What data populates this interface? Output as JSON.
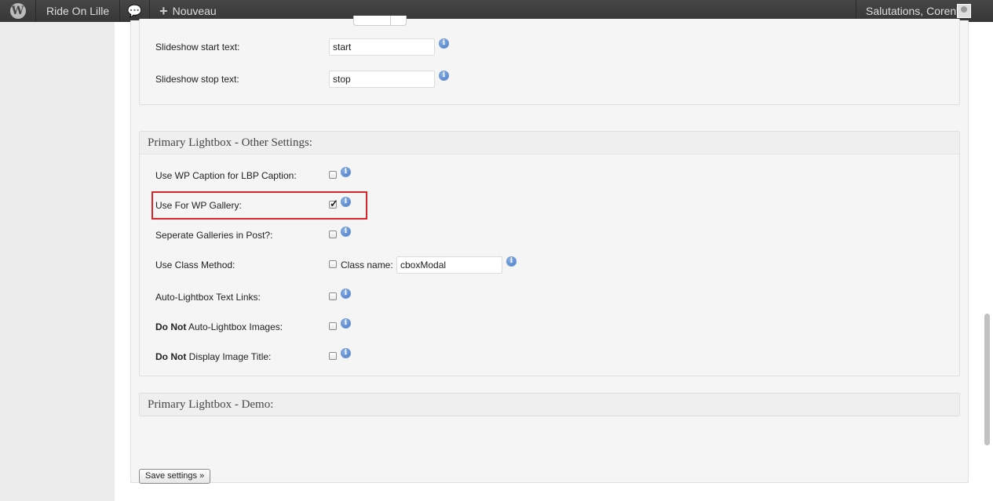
{
  "adminbar": {
    "site_name": "Ride On Lille",
    "new_label": "Nouveau",
    "greeting": "Salutations, Corentin"
  },
  "slideshow_section": {
    "rows": [
      {
        "label": "Slideshow start text:",
        "value": "start"
      },
      {
        "label": "Slideshow stop text:",
        "value": "stop"
      }
    ]
  },
  "other_settings": {
    "title": "Primary Lightbox - Other Settings:",
    "rows": [
      {
        "label": "Use WP Caption for LBP Caption:",
        "checked": false
      },
      {
        "label": "Use For WP Gallery:",
        "checked": true
      },
      {
        "label": "Seperate Galleries in Post?:",
        "checked": false
      },
      {
        "label": "Use Class Method:",
        "checked": false,
        "class_name_label": "Class name:",
        "class_name_value": "cboxModal"
      },
      {
        "label": "Auto-Lightbox Text Links:",
        "checked": false
      },
      {
        "label_bold": "Do Not",
        "label_rest": " Auto-Lightbox Images:",
        "checked": false
      },
      {
        "label_bold": "Do Not",
        "label_rest": " Display Image Title:",
        "checked": false
      }
    ]
  },
  "demo_section": {
    "title": "Primary Lightbox - Demo:"
  },
  "save_button": "Save settings »",
  "icons": {
    "wordpress": "wordpress-logo-icon",
    "comments": "comment-bubble-icon",
    "info": "info-icon",
    "avatar": "user-avatar-icon"
  },
  "colors": {
    "adminbar": "#464646",
    "highlight": "#d6262a",
    "info": "#3b6fc0"
  }
}
